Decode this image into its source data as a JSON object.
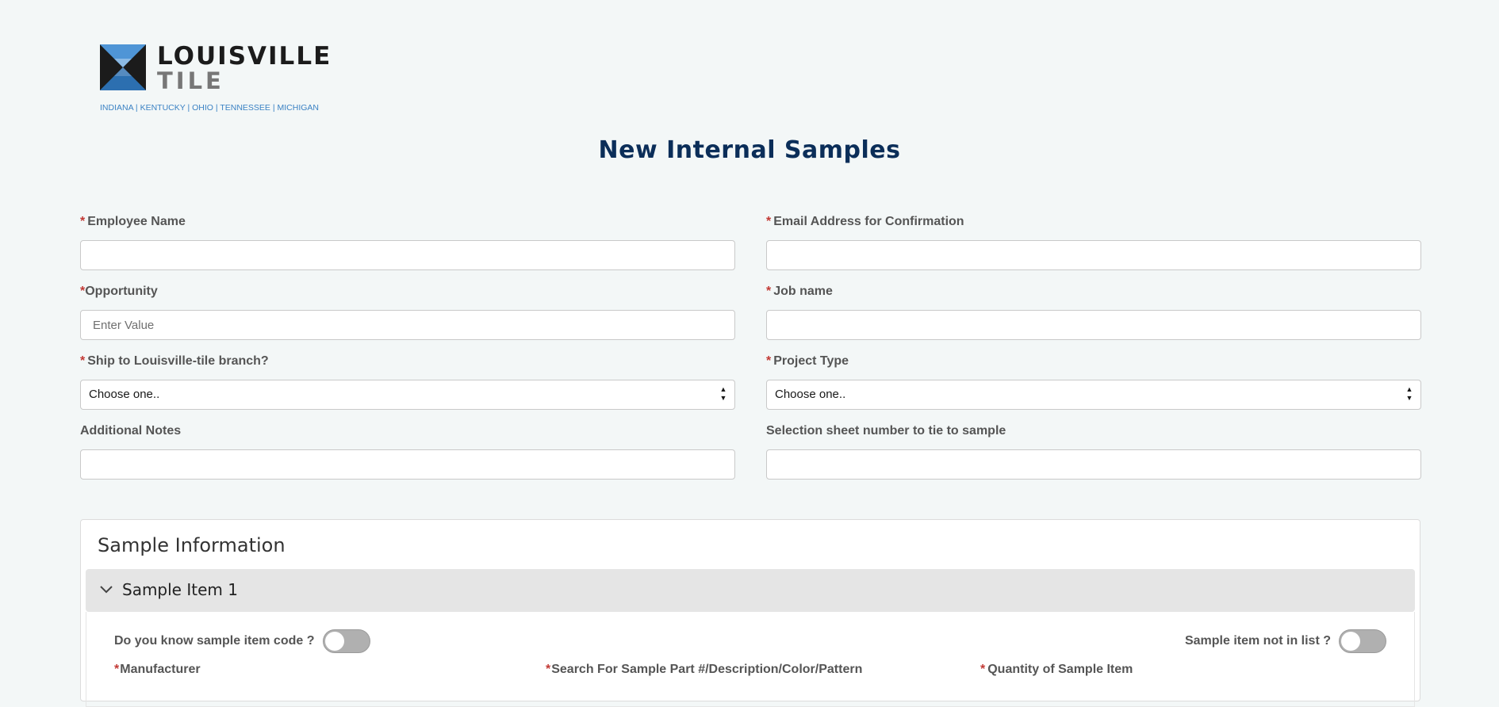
{
  "brand": {
    "line1": "LOUISVILLE",
    "line2": "TILE",
    "tagline": "INDIANA | KENTUCKY | OHIO | TENNESSEE | MICHIGAN",
    "colors": {
      "blue": "#3b82c4",
      "dark": "#1b1b1b",
      "gray": "#777777"
    }
  },
  "page": {
    "title": "New Internal Samples"
  },
  "form": {
    "employee_name": {
      "label": "Employee Name",
      "required": "*",
      "value": ""
    },
    "email": {
      "label": "Email Address for Confirmation",
      "required": "*",
      "value": ""
    },
    "opportunity": {
      "label": "Opportunity",
      "required": "*",
      "placeholder": "Enter Value",
      "value": ""
    },
    "job_name": {
      "label": "Job name",
      "required": "*",
      "value": ""
    },
    "ship_branch": {
      "label": "Ship to Louisville-tile branch?",
      "required": "*",
      "selected": "Choose one.."
    },
    "project_type": {
      "label": "Project Type",
      "required": "*",
      "selected": "Choose one.."
    },
    "additional_notes": {
      "label": "Additional Notes",
      "value": ""
    },
    "selection_sheet": {
      "label": "Selection sheet number to tie to sample",
      "value": ""
    }
  },
  "sample_info": {
    "title": "Sample Information",
    "item": {
      "label": "Sample Item 1",
      "know_code_toggle": {
        "label": "Do you know sample item code ?",
        "state": "off"
      },
      "not_in_list_toggle": {
        "label": "Sample item not in list ?",
        "state": "off"
      },
      "manufacturer_label": "Manufacturer",
      "search_label": "Search For Sample Part #/Description/Color/Pattern",
      "quantity_label": "Quantity of Sample Item",
      "required": "*"
    }
  },
  "icons": [
    "chevron-down-icon",
    "select-arrows-icon",
    "logo-mark-icon"
  ]
}
